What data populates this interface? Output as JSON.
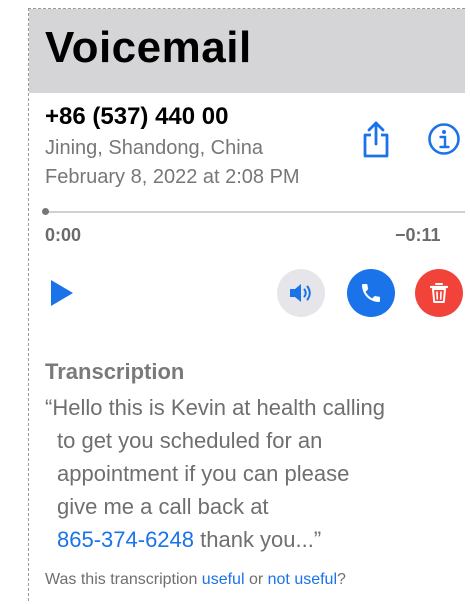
{
  "header": {
    "title": "Voicemail"
  },
  "caller": {
    "phone": "+86 (537) 440 00",
    "location": "Jining, Shandong, China",
    "datetime": "February 8, 2022 at 2:08 PM"
  },
  "playback": {
    "elapsed": "0:00",
    "remaining": "−0:11",
    "progress": 0
  },
  "icons": {
    "share": "share-icon",
    "info": "info-icon",
    "play": "play-icon",
    "speaker": "speaker-icon",
    "call": "phone-icon",
    "delete": "trash-icon"
  },
  "colors": {
    "accent": "#1a73e8",
    "delete": "#f2433a",
    "header_bg": "#d5d5d7"
  },
  "transcription": {
    "heading": "Transcription",
    "line1": "“Hello this is Kevin at health calling",
    "line2": "to get you scheduled for an",
    "line3": "appointment if you can please",
    "line4": "give me a call back at",
    "phone_link": "865-374-6248",
    "line5_rest": " thank you...”",
    "feedback_prefix": "Was this transcription ",
    "feedback_useful": "useful",
    "feedback_or": " or ",
    "feedback_not_useful": "not useful",
    "feedback_suffix": "?"
  }
}
